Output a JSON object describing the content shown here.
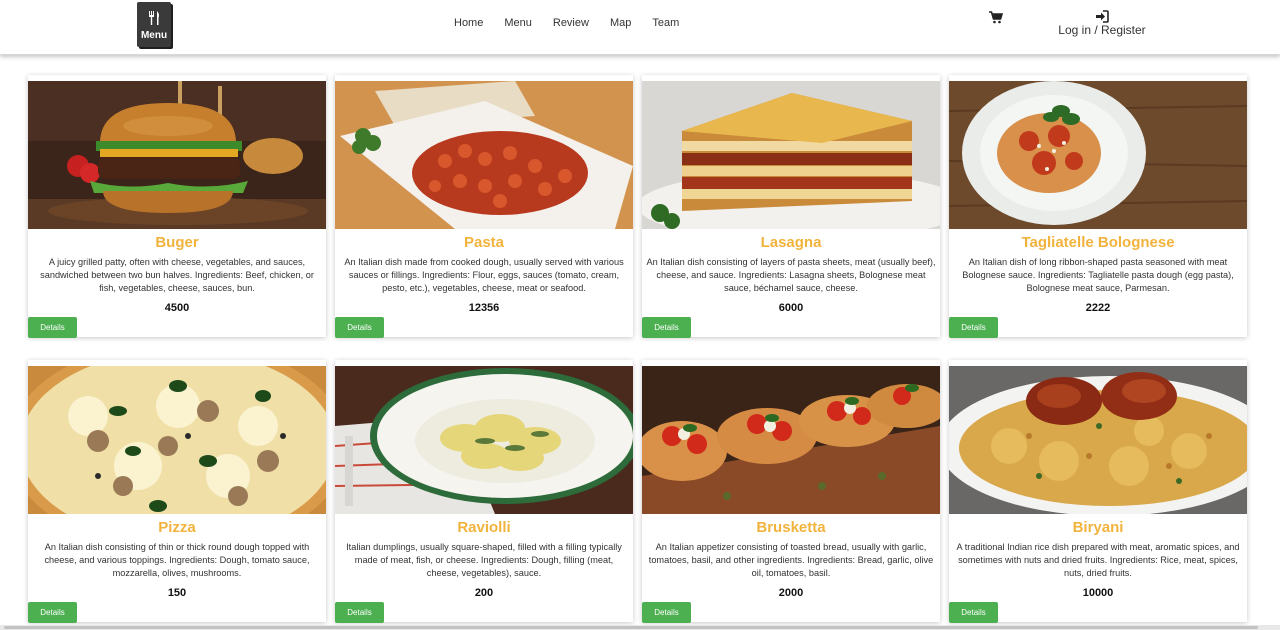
{
  "brand": {
    "logo_text": "Menu"
  },
  "nav": {
    "links": [
      "Home",
      "Menu",
      "Review",
      "Map",
      "Team"
    ],
    "login_label": "Log in / Register"
  },
  "accent_colors": {
    "title": "#f2b33d",
    "button": "#4caf50"
  },
  "icons": {
    "cart": "cart-icon",
    "login": "login-icon"
  },
  "menu": {
    "button_label": "Details",
    "items": [
      {
        "name": "Buger",
        "description": "A juicy grilled patty, often with cheese, vegetables, and sauces, sandwiched between two bun halves. Ingredients: Beef, chicken, or fish, vegetables, cheese, sauces, bun.",
        "price": "4500"
      },
      {
        "name": "Pasta",
        "description": "An Italian dish made from cooked dough, usually served with various sauces or fillings. Ingredients: Flour, eggs, sauces (tomato, cream, pesto, etc.), vegetables, cheese, meat or seafood.",
        "price": "12356"
      },
      {
        "name": "Lasagna",
        "description": "An Italian dish consisting of layers of pasta sheets, meat (usually beef), cheese, and sauce. Ingredients: Lasagna sheets, Bolognese meat sauce, béchamel sauce, cheese.",
        "price": "6000"
      },
      {
        "name": "Tagliatelle Bolognese",
        "description": "An Italian dish of long ribbon-shaped pasta seasoned with meat Bolognese sauce. Ingredients: Tagliatelle pasta dough (egg pasta), Bolognese meat sauce, Parmesan.",
        "price": "2222"
      },
      {
        "name": "Pizza",
        "description": "An Italian dish consisting of thin or thick round dough topped with cheese, and various toppings. Ingredients: Dough, tomato sauce, mozzarella, olives, mushrooms.",
        "price": "150"
      },
      {
        "name": "Raviolli",
        "description": "Italian dumplings, usually square-shaped, filled with a filling typically made of meat, fish, or cheese. Ingredients: Dough, filling (meat, cheese, vegetables), sauce.",
        "price": "200"
      },
      {
        "name": "Brusketta",
        "description": "An Italian appetizer consisting of toasted bread, usually with garlic, tomatoes, basil, and other ingredients. Ingredients: Bread, garlic, olive oil, tomatoes, basil.",
        "price": "2000"
      },
      {
        "name": "Biryani",
        "description": "A traditional Indian rice dish prepared with meat, aromatic spices, and sometimes with nuts and dried fruits. Ingredients: Rice, meat, spices, nuts, dried fruits.",
        "price": "10000"
      }
    ]
  }
}
